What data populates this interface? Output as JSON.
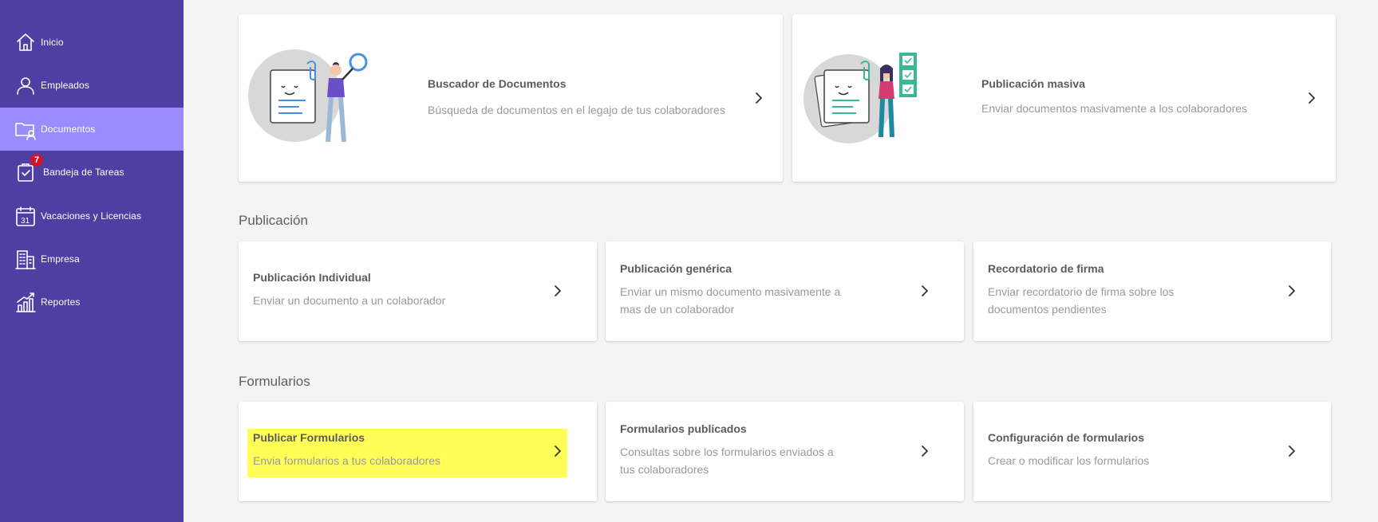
{
  "sidebar": {
    "items": [
      {
        "label": "Inicio",
        "icon": "home-icon",
        "active": false
      },
      {
        "label": "Empleados",
        "icon": "user-icon",
        "active": false
      },
      {
        "label": "Documentos",
        "icon": "folder-user-icon",
        "active": true
      },
      {
        "label": "Bandeja de Tareas",
        "icon": "clipboard-check-icon",
        "active": false,
        "badge": "7"
      },
      {
        "label": "Vacaciones y Licencias",
        "icon": "calendar-icon",
        "active": false,
        "calendar_day": "31"
      },
      {
        "label": "Empresa",
        "icon": "building-icon",
        "active": false
      },
      {
        "label": "Reportes",
        "icon": "chart-growth-icon",
        "active": false
      }
    ]
  },
  "top_cards": [
    {
      "title": "Buscador de Documentos",
      "description": "Búsqueda de documentos en el legajo de tus colaboradores"
    },
    {
      "title": "Publicación masiva",
      "description": "Enviar documentos masivamente a los colaboradores"
    }
  ],
  "sections": {
    "publicacion": {
      "title": "Publicación",
      "cards": [
        {
          "title": "Publicación Individual",
          "description_lines": [
            "Enviar un documento a un colaborador"
          ]
        },
        {
          "title": "Publicación genérica",
          "description_lines": [
            "Enviar un mismo documento masivamente a",
            "mas de un colaborador"
          ]
        },
        {
          "title": "Recordatorio de firma",
          "description_lines": [
            "Enviar recordatorio de firma sobre los",
            "documentos pendientes"
          ]
        }
      ]
    },
    "formularios": {
      "title": "Formularios",
      "cards": [
        {
          "title": "Publicar Formularios",
          "description_lines": [
            "Envia formularios a tus colaboradores"
          ],
          "highlighted": true
        },
        {
          "title": "Formularios publicados",
          "description_lines": [
            "Consultas sobre los formularios enviados a",
            "tus colaboradores"
          ]
        },
        {
          "title": "Configuración de formularios",
          "description_lines": [
            "Crear o modificar los formularios"
          ]
        }
      ]
    }
  },
  "colors": {
    "sidebar_bg": "#4f3fa3",
    "sidebar_active": "#9a8cff",
    "badge": "#d0152b",
    "highlight": "#ffff55",
    "page_bg": "#f4f4f4"
  }
}
